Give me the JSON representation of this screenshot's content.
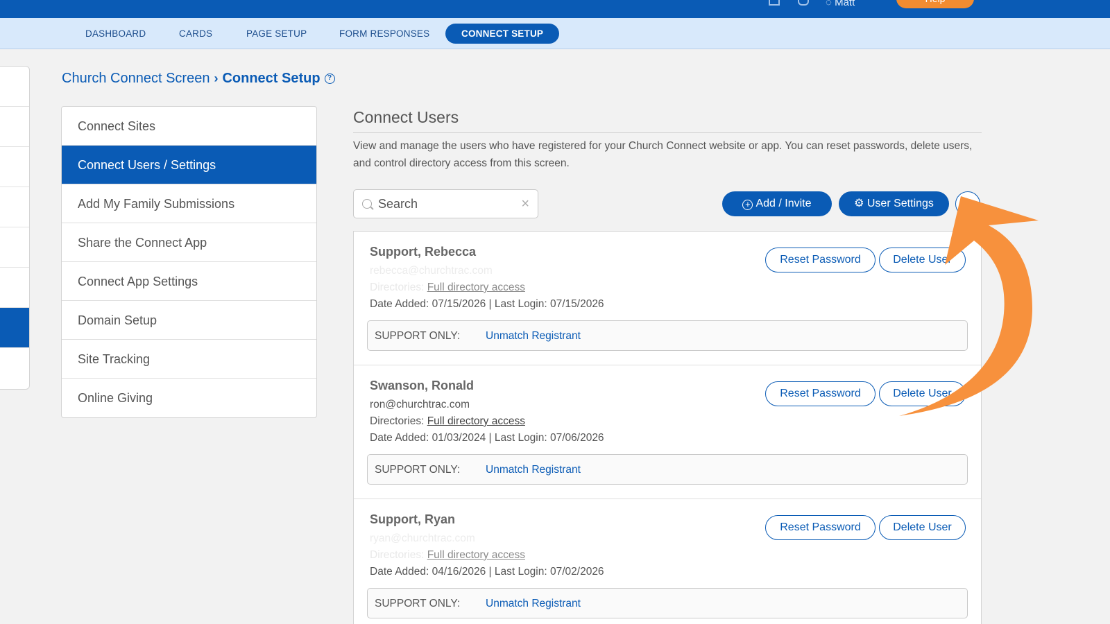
{
  "topbar": {
    "user_name": "Matt",
    "help_label": "Help"
  },
  "subnav": {
    "tabs": [
      {
        "label": "DASHBOARD"
      },
      {
        "label": "CARDS"
      },
      {
        "label": "PAGE SETUP"
      },
      {
        "label": "FORM RESPONSES"
      },
      {
        "label": "CONNECT SETUP",
        "active": true
      }
    ]
  },
  "breadcrumb": {
    "parent": "Church Connect Screen",
    "current": "Connect Setup"
  },
  "sidemenu": {
    "items": [
      {
        "label": "Connect Sites"
      },
      {
        "label": "Connect Users / Settings",
        "active": true
      },
      {
        "label": "Add My Family Submissions"
      },
      {
        "label": "Share the Connect App"
      },
      {
        "label": "Connect App Settings"
      },
      {
        "label": "Domain Setup"
      },
      {
        "label": "Site Tracking"
      },
      {
        "label": "Online Giving"
      }
    ]
  },
  "panel": {
    "title": "Connect Users",
    "description": "View and manage the users who have registered for your Church Connect website or app. You can reset passwords, delete users, and control directory access from this screen."
  },
  "search": {
    "placeholder": "Search"
  },
  "actions": {
    "add_invite": "Add / Invite",
    "user_settings": "User Settings"
  },
  "users": [
    {
      "name": "Support, Rebecca",
      "email": "rebecca@churchtrac.com",
      "directories_label": "Directories:",
      "directory_access": "Full directory access",
      "dates": "Date Added: 07/15/2026 | Last Login: 07/15/2026",
      "reset_label": "Reset Password",
      "delete_label": "Delete User",
      "support_label": "SUPPORT ONLY:",
      "unmatch_label": "Unmatch Registrant",
      "obscured": true
    },
    {
      "name": "Swanson, Ronald",
      "email": "ron@churchtrac.com",
      "directories_label": "Directories:",
      "directory_access": "Full directory access",
      "dates": "Date Added: 01/03/2024 | Last Login: 07/06/2026",
      "reset_label": "Reset Password",
      "delete_label": "Delete User",
      "support_label": "SUPPORT ONLY:",
      "unmatch_label": "Unmatch Registrant",
      "obscured": false
    },
    {
      "name": "Support, Ryan",
      "email": "ryan@churchtrac.com",
      "directories_label": "Directories:",
      "directory_access": "Full directory access",
      "dates": "Date Added: 04/16/2026 | Last Login: 07/02/2026",
      "reset_label": "Reset Password",
      "delete_label": "Delete User",
      "support_label": "SUPPORT ONLY:",
      "unmatch_label": "Unmatch Registrant",
      "obscured": true
    }
  ],
  "colors": {
    "brand_blue": "#0a5bb5",
    "subnav_bg": "#d8e9fb",
    "annotation_orange": "#f7913d"
  }
}
